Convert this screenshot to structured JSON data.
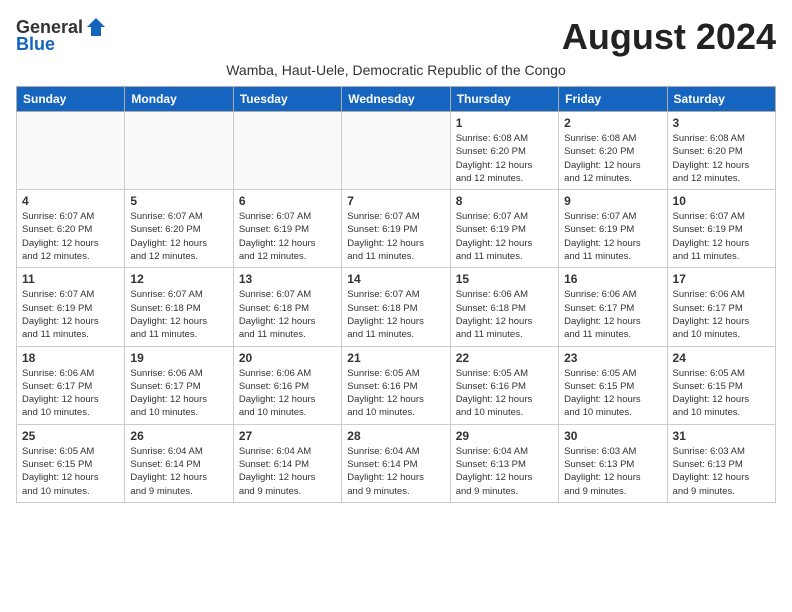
{
  "header": {
    "logo_general": "General",
    "logo_blue": "Blue",
    "month_year": "August 2024",
    "subtitle": "Wamba, Haut-Uele, Democratic Republic of the Congo"
  },
  "days_of_week": [
    "Sunday",
    "Monday",
    "Tuesday",
    "Wednesday",
    "Thursday",
    "Friday",
    "Saturday"
  ],
  "weeks": [
    [
      {
        "day": "",
        "info": ""
      },
      {
        "day": "",
        "info": ""
      },
      {
        "day": "",
        "info": ""
      },
      {
        "day": "",
        "info": ""
      },
      {
        "day": "1",
        "info": "Sunrise: 6:08 AM\nSunset: 6:20 PM\nDaylight: 12 hours\nand 12 minutes."
      },
      {
        "day": "2",
        "info": "Sunrise: 6:08 AM\nSunset: 6:20 PM\nDaylight: 12 hours\nand 12 minutes."
      },
      {
        "day": "3",
        "info": "Sunrise: 6:08 AM\nSunset: 6:20 PM\nDaylight: 12 hours\nand 12 minutes."
      }
    ],
    [
      {
        "day": "4",
        "info": "Sunrise: 6:07 AM\nSunset: 6:20 PM\nDaylight: 12 hours\nand 12 minutes."
      },
      {
        "day": "5",
        "info": "Sunrise: 6:07 AM\nSunset: 6:20 PM\nDaylight: 12 hours\nand 12 minutes."
      },
      {
        "day": "6",
        "info": "Sunrise: 6:07 AM\nSunset: 6:19 PM\nDaylight: 12 hours\nand 12 minutes."
      },
      {
        "day": "7",
        "info": "Sunrise: 6:07 AM\nSunset: 6:19 PM\nDaylight: 12 hours\nand 11 minutes."
      },
      {
        "day": "8",
        "info": "Sunrise: 6:07 AM\nSunset: 6:19 PM\nDaylight: 12 hours\nand 11 minutes."
      },
      {
        "day": "9",
        "info": "Sunrise: 6:07 AM\nSunset: 6:19 PM\nDaylight: 12 hours\nand 11 minutes."
      },
      {
        "day": "10",
        "info": "Sunrise: 6:07 AM\nSunset: 6:19 PM\nDaylight: 12 hours\nand 11 minutes."
      }
    ],
    [
      {
        "day": "11",
        "info": "Sunrise: 6:07 AM\nSunset: 6:19 PM\nDaylight: 12 hours\nand 11 minutes."
      },
      {
        "day": "12",
        "info": "Sunrise: 6:07 AM\nSunset: 6:18 PM\nDaylight: 12 hours\nand 11 minutes."
      },
      {
        "day": "13",
        "info": "Sunrise: 6:07 AM\nSunset: 6:18 PM\nDaylight: 12 hours\nand 11 minutes."
      },
      {
        "day": "14",
        "info": "Sunrise: 6:07 AM\nSunset: 6:18 PM\nDaylight: 12 hours\nand 11 minutes."
      },
      {
        "day": "15",
        "info": "Sunrise: 6:06 AM\nSunset: 6:18 PM\nDaylight: 12 hours\nand 11 minutes."
      },
      {
        "day": "16",
        "info": "Sunrise: 6:06 AM\nSunset: 6:17 PM\nDaylight: 12 hours\nand 11 minutes."
      },
      {
        "day": "17",
        "info": "Sunrise: 6:06 AM\nSunset: 6:17 PM\nDaylight: 12 hours\nand 10 minutes."
      }
    ],
    [
      {
        "day": "18",
        "info": "Sunrise: 6:06 AM\nSunset: 6:17 PM\nDaylight: 12 hours\nand 10 minutes."
      },
      {
        "day": "19",
        "info": "Sunrise: 6:06 AM\nSunset: 6:17 PM\nDaylight: 12 hours\nand 10 minutes."
      },
      {
        "day": "20",
        "info": "Sunrise: 6:06 AM\nSunset: 6:16 PM\nDaylight: 12 hours\nand 10 minutes."
      },
      {
        "day": "21",
        "info": "Sunrise: 6:05 AM\nSunset: 6:16 PM\nDaylight: 12 hours\nand 10 minutes."
      },
      {
        "day": "22",
        "info": "Sunrise: 6:05 AM\nSunset: 6:16 PM\nDaylight: 12 hours\nand 10 minutes."
      },
      {
        "day": "23",
        "info": "Sunrise: 6:05 AM\nSunset: 6:15 PM\nDaylight: 12 hours\nand 10 minutes."
      },
      {
        "day": "24",
        "info": "Sunrise: 6:05 AM\nSunset: 6:15 PM\nDaylight: 12 hours\nand 10 minutes."
      }
    ],
    [
      {
        "day": "25",
        "info": "Sunrise: 6:05 AM\nSunset: 6:15 PM\nDaylight: 12 hours\nand 10 minutes."
      },
      {
        "day": "26",
        "info": "Sunrise: 6:04 AM\nSunset: 6:14 PM\nDaylight: 12 hours\nand 9 minutes."
      },
      {
        "day": "27",
        "info": "Sunrise: 6:04 AM\nSunset: 6:14 PM\nDaylight: 12 hours\nand 9 minutes."
      },
      {
        "day": "28",
        "info": "Sunrise: 6:04 AM\nSunset: 6:14 PM\nDaylight: 12 hours\nand 9 minutes."
      },
      {
        "day": "29",
        "info": "Sunrise: 6:04 AM\nSunset: 6:13 PM\nDaylight: 12 hours\nand 9 minutes."
      },
      {
        "day": "30",
        "info": "Sunrise: 6:03 AM\nSunset: 6:13 PM\nDaylight: 12 hours\nand 9 minutes."
      },
      {
        "day": "31",
        "info": "Sunrise: 6:03 AM\nSunset: 6:13 PM\nDaylight: 12 hours\nand 9 minutes."
      }
    ]
  ]
}
